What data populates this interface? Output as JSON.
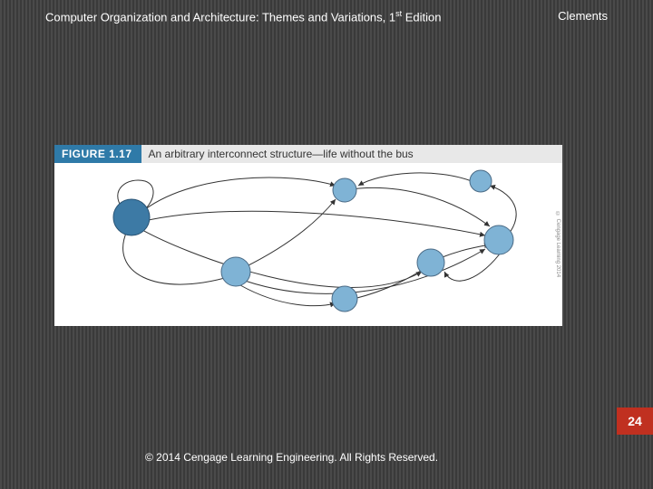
{
  "header": {
    "title_main": "Computer Organization and Architecture: Themes and Variations, 1",
    "title_ord": "st",
    "title_suffix": " Edition",
    "author": "Clements"
  },
  "figure": {
    "label": "FIGURE 1.17",
    "caption": "An arbitrary interconnect structure—life without the bus",
    "side_credit": "© Cengage Learning 2014"
  },
  "page_number": "24",
  "copyright": "© 2014 Cengage Learning Engineering. All Rights Reserved."
}
